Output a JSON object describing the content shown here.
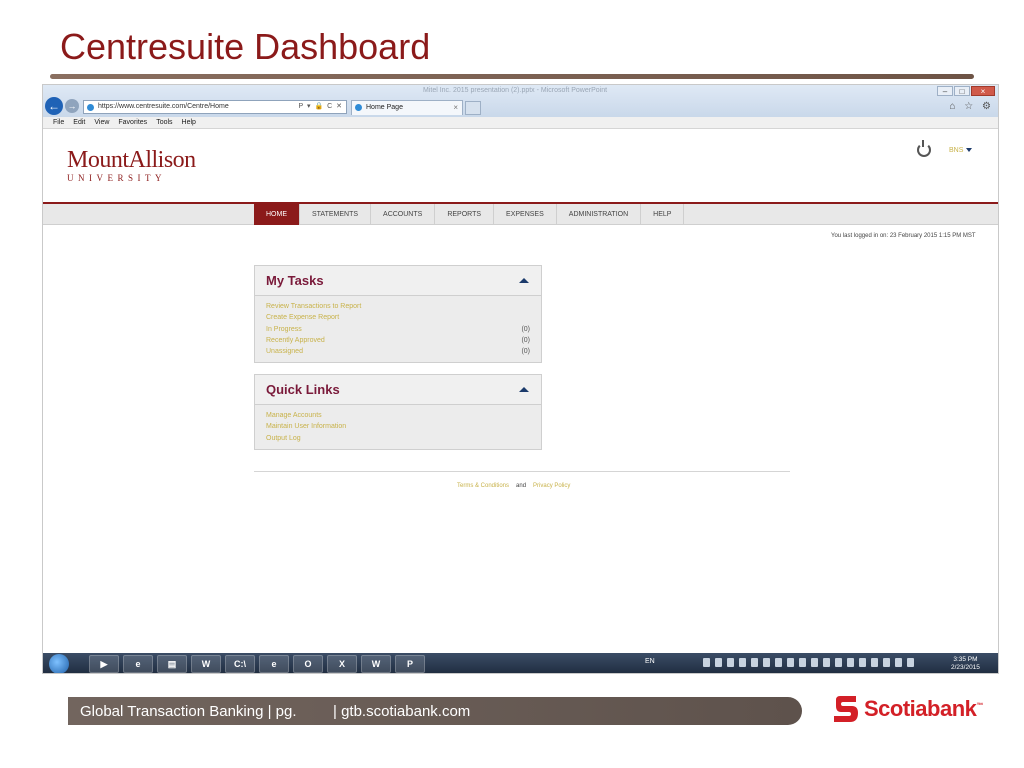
{
  "slide": {
    "title": "Centresuite Dashboard",
    "footer_left": "Global Transaction Banking | pg.",
    "footer_right": "| gtb.scotiabank.com",
    "brand": "Scotiabank",
    "brand_mark": "™",
    "accent_color": "#8b1a1a",
    "brand_color": "#d32027"
  },
  "browser": {
    "window_title": "Mitel Inc. 2015 presentation (2).pptx - Microsoft PowerPoint",
    "window_controls": [
      "–",
      "□",
      "×"
    ],
    "address": "https://www.centresuite.com/Centre/Home",
    "address_icons": "P ▾ 🔒 C ✕",
    "tab_label": "Home Page",
    "tab_close": "×",
    "right_icons": "⌂ ☆ ⚙",
    "menu": [
      "File",
      "Edit",
      "View",
      "Favorites",
      "Tools",
      "Help"
    ]
  },
  "app": {
    "logo_main": "MountAllison",
    "logo_sub": "UNIVERSITY",
    "user": "BNS",
    "nav": [
      "HOME",
      "STATEMENTS",
      "ACCOUNTS",
      "REPORTS",
      "EXPENSES",
      "ADMINISTRATION",
      "HELP"
    ],
    "last_login": "You last logged in on: 23 February 2015 1:15 PM MST",
    "my_tasks": {
      "title": "My Tasks",
      "items": [
        {
          "label": "Review Transactions to Report",
          "count": ""
        },
        {
          "label": "Create Expense Report",
          "count": ""
        },
        {
          "label": "In Progress",
          "count": "(0)"
        },
        {
          "label": "Recently Approved",
          "count": "(0)"
        },
        {
          "label": "Unassigned",
          "count": "(0)"
        }
      ]
    },
    "quick_links": {
      "title": "Quick Links",
      "items": [
        "Manage Accounts",
        "Maintain User Information",
        "Output Log"
      ]
    },
    "footer": {
      "terms": "Terms & Conditions",
      "and": "and",
      "privacy": "Privacy Policy"
    }
  },
  "taskbar": {
    "apps": [
      "▶",
      "e",
      "▤",
      "W",
      "C:\\",
      "e",
      "O",
      "X",
      "W",
      "P"
    ],
    "lang": "EN",
    "time": "3:35 PM",
    "date": "2/23/2015"
  }
}
